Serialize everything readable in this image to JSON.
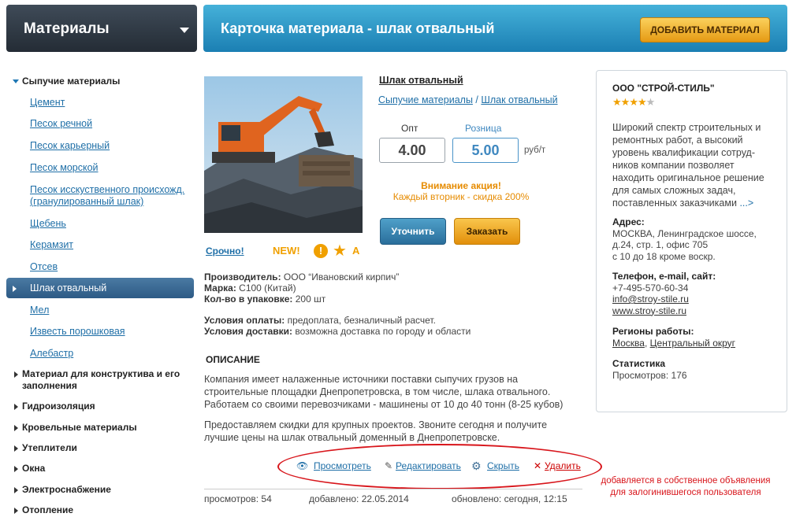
{
  "header": {
    "section_title": "Материалы",
    "page_title": "Карточка материала  -  шлак отвальный",
    "add_button": "ДОБАВИТЬ МАТЕРИАЛ"
  },
  "sidebar": {
    "groups": [
      {
        "label": "Сыпучие материалы",
        "expanded": true,
        "items": [
          "Цемент",
          "Песок речной",
          "Песок карьерный",
          "Песок морской",
          "Песок исскуственного происхожд.",
          "(гранулированный шлак)",
          "Щебень",
          "Керамзит",
          "Отсев",
          "Шлак отвальный",
          "Мел",
          "Известь порошковая",
          "Алебастр"
        ]
      },
      {
        "label": "Материал для конструктива  и его",
        "label2": "заполнения"
      },
      {
        "label": "Гидроизоляция"
      },
      {
        "label": "Кровельные материалы"
      },
      {
        "label": "Утеплители"
      },
      {
        "label": "Окна"
      },
      {
        "label": "Электроснабжение"
      },
      {
        "label": "Отопление"
      }
    ]
  },
  "product": {
    "title": "Шлак отвальный",
    "crumb_parent": "Сыпучие материалы",
    "crumb_sep": "/",
    "crumb_current": "Шлак отвальный",
    "wholesale_label": "Опт",
    "retail_label": "Розница",
    "wholesale_price": "4.00",
    "retail_price": "5.00",
    "unit": "руб/т",
    "promo_title": "Внимание акция!",
    "promo_text": "Каждый вторник - скидка 200%",
    "clarify_button": "Уточнить",
    "order_button": "Заказать",
    "urgent": "Срочно!",
    "new_badge": "NEW!",
    "warn_symbol": "!",
    "star_symbol": "★",
    "a_badge": "A",
    "manufacturer_label": "Производитель:",
    "manufacturer": " ООО “Ивановский кирпич”",
    "brand_label": "Марка:",
    "brand": " С100 (Китай)",
    "pack_label": "Кол-во в упаковке:",
    "pack": " 200 шт",
    "payment_label": "Условия оплаты:",
    "payment": " предоплата, безналичный расчет.",
    "delivery_label": "Условия доставки:",
    "delivery": " возможна доставка по городу и области",
    "desc_heading": "ОПИСАНИЕ",
    "desc_p1": "Компания имеет налаженные источники поставки сыпучих грузов на строительные площадки Днепропетровска, в том числе, шлака отвального. Работаем со своими перевозчиками - машинены от 10 до 40 тонн (8-25 кубов)",
    "desc_p2": "Предоставляем скидки для крупных проектов. Звоните сегодня и получите лучшие цены на шлак отвальный доменный в Днепропетровске."
  },
  "actions": {
    "view": "Просмотреть",
    "edit": "Редактировать",
    "hide": "Скрыть",
    "delete": "Удалить",
    "note": "добавляется в собственное объявления для залогинившегося пользователя"
  },
  "footer": {
    "views": "просмотров: 54",
    "added": "добавлено: 22.05.2014",
    "updated": "обновлено: сегодня, 12:15"
  },
  "seller": {
    "company": "ООО \"СТРОЙ-СТИЛЬ\"",
    "rating": 4,
    "rating_max": 5,
    "about": "Широкий спектр строительных и ремонтных работ, а высокий уровень квалификации сотруд-ников компании позволяет находить оригинальное решение для самых сложных задач, поставленных заказчиками",
    "more": "...>",
    "address_label": "Адрес:",
    "address": "МОСКВА, Ленинградское шоссе, д.24, стр. 1, офис 705",
    "hours": "с 10 до 18 кроме воскр.",
    "contacts_label": "Телефон, e-mail, сайт:",
    "phone": "+7-495-570-60-34",
    "email": "info@stroy-stile.ru",
    "site": "www.stroy-stile.ru",
    "regions_label": "Регионы работы:",
    "region1": "Москва",
    "region_sep": ", ",
    "region2": "Центральный округ",
    "stats_label": "Статистика",
    "stats": "Просмотров: 176"
  },
  "colors": {
    "accent_blue": "#1f78b4",
    "orange": "#e59a14",
    "annotation_red": "#d8151b"
  }
}
